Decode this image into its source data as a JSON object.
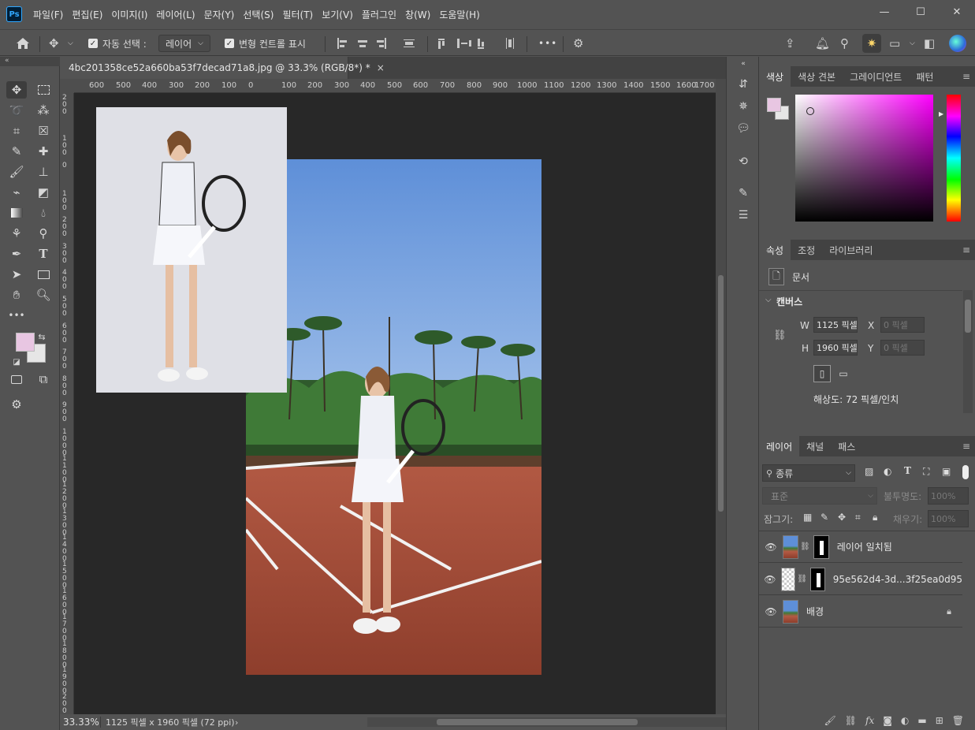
{
  "app": {
    "logo": "Ps",
    "menu": [
      "파일(F)",
      "편집(E)",
      "이미지(I)",
      "레이어(L)",
      "문자(Y)",
      "선택(S)",
      "필터(T)",
      "보기(V)",
      "플러그인",
      "창(W)",
      "도움말(H)"
    ],
    "window_controls": [
      "—",
      "☐",
      "✕"
    ]
  },
  "options": {
    "auto_select_label": "자동 선택 :",
    "auto_select_value": "레이어",
    "transform_controls_label": "변형 컨트롤 표시",
    "more": "•••"
  },
  "document": {
    "tab_title": "4bc201358ce52a660ba53f7decad71a8.jpg @ 33.3% (RGB/8*) *",
    "close": "×",
    "zoom": "33.33%",
    "info": "1125 픽셀 x 1960 픽셀 (72 ppi)",
    "ruler_top": [
      "600",
      "500",
      "400",
      "300",
      "200",
      "100",
      "0",
      "100",
      "200",
      "300",
      "400",
      "500",
      "600",
      "700",
      "800",
      "900",
      "1000",
      "1100",
      "1200",
      "1300",
      "1400",
      "1500",
      "1600",
      "1700"
    ],
    "ruler_left": [
      "2 0 0",
      "1 0 0",
      "0",
      "1 0 0",
      "2 0 0",
      "3 0 0",
      "4 0 0",
      "5 0 0",
      "6 0 0",
      "7 0 0",
      "8 0 0",
      "9 0 0",
      "1 0 0 0",
      "1 1 0 0",
      "1 2 0 0",
      "1 3 0 0",
      "1 4 0 0",
      "1 5 0 0",
      "1 6 0 0",
      "1 7 0 0",
      "1 8 0 0",
      "1 9 0 0",
      "2 0 0 0"
    ]
  },
  "color_panel": {
    "tabs": [
      "색상",
      "색상 견본",
      "그레이디언트",
      "패턴"
    ],
    "foreground": "#e8c6e2",
    "background": "#e6e6e6"
  },
  "properties": {
    "tabs": [
      "속성",
      "조정",
      "라이브러리"
    ],
    "doc_label": "문서",
    "canvas_header": "캔버스",
    "w_label": "W",
    "w_value": "1125 픽셀",
    "h_label": "H",
    "h_value": "1960 픽셀",
    "x_label": "X",
    "x_value": "0 픽셀",
    "y_label": "Y",
    "y_value": "0 픽셀",
    "resolution": "해상도: 72 픽셀/인치"
  },
  "layers": {
    "tabs": [
      "레이어",
      "채널",
      "패스"
    ],
    "filter_kind": "종류",
    "blend_mode": "표준",
    "opacity_label": "불투명도:",
    "opacity_value": "100%",
    "lock_label": "잠그기:",
    "fill_label": "채우기:",
    "fill_value": "100%",
    "items": [
      {
        "name": "레이어 일치됨"
      },
      {
        "name": "95e562d4-3d...3f25ea0d95"
      },
      {
        "name": "배경"
      }
    ]
  }
}
